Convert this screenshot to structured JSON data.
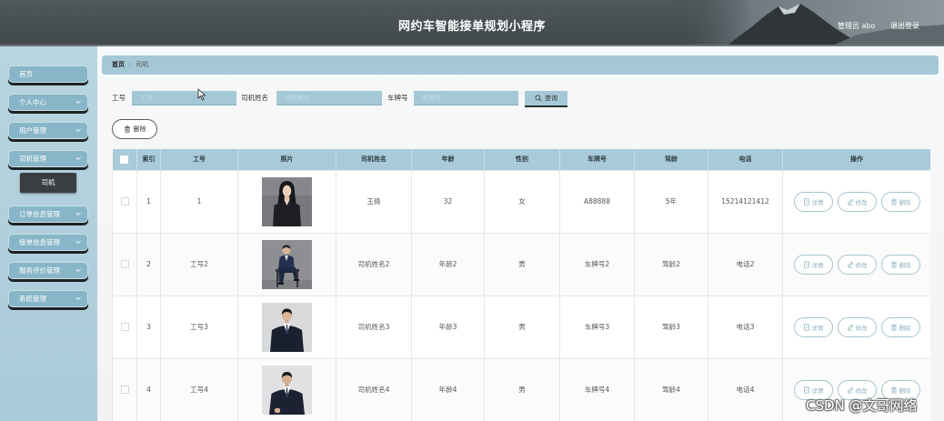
{
  "header": {
    "title": "网约车智能接单规划小程序",
    "user_label": "管理员 abo",
    "logout_label": "退出登录"
  },
  "sidebar": {
    "items": [
      {
        "label": "首页",
        "expandable": false
      },
      {
        "label": "个人中心",
        "expandable": true
      },
      {
        "label": "用户管理",
        "expandable": true
      },
      {
        "label": "司机管理",
        "expandable": true,
        "expanded": true,
        "children": [
          {
            "label": "司机",
            "active": true
          }
        ]
      },
      {
        "label": "订单信息管理",
        "expandable": true
      },
      {
        "label": "接单信息管理",
        "expandable": true
      },
      {
        "label": "服务评价管理",
        "expandable": true
      },
      {
        "label": "系统管理",
        "expandable": true
      }
    ],
    "chevron_icon": "chevron-down-icon"
  },
  "breadcrumb": {
    "home": "首页",
    "separator": "/",
    "current": "司机"
  },
  "search": {
    "fields": [
      {
        "label": "工号",
        "value": "",
        "placeholder": "工号"
      },
      {
        "label": "司机姓名",
        "value": "",
        "placeholder": "司机姓名"
      },
      {
        "label": "车牌号",
        "value": "",
        "placeholder": "车牌号"
      }
    ],
    "button_label": "查询",
    "button_icon": "search-icon"
  },
  "toolbar": {
    "delete_label": "删除",
    "delete_icon": "trash-icon"
  },
  "table": {
    "columns": [
      "索引",
      "工号",
      "照片",
      "司机姓名",
      "年龄",
      "性别",
      "车牌号",
      "驾龄",
      "电话",
      "操作"
    ],
    "rows": [
      {
        "index": "1",
        "job_no": "1",
        "name": "王倩",
        "age": "32",
        "gender": "女",
        "plate": "A88888",
        "driving_years": "5年",
        "phone": "15214121412"
      },
      {
        "index": "2",
        "job_no": "工号2",
        "name": "司机姓名2",
        "age": "年龄2",
        "gender": "男",
        "plate": "车牌号2",
        "driving_years": "驾龄2",
        "phone": "电话2"
      },
      {
        "index": "3",
        "job_no": "工号3",
        "name": "司机姓名3",
        "age": "年龄3",
        "gender": "男",
        "plate": "车牌号3",
        "driving_years": "驾龄3",
        "phone": "电话3"
      },
      {
        "index": "4",
        "job_no": "工号4",
        "name": "司机姓名4",
        "age": "年龄4",
        "gender": "男",
        "plate": "车牌号4",
        "driving_years": "驾龄4",
        "phone": "电话4"
      }
    ],
    "row_actions": [
      {
        "label": "详情",
        "icon": "file-icon"
      },
      {
        "label": "修改",
        "icon": "edit-icon"
      },
      {
        "label": "删除",
        "icon": "trash-icon"
      }
    ]
  },
  "watermark": "CSDN @文哥网络",
  "colors": {
    "header_bg": "#41484b",
    "sidebar_bg": "#a9cad8",
    "accent": "#a5c8d6",
    "table_header_bg": "#a9cbd9",
    "submenu_active_bg": "#3b3e40",
    "nav_item_bg": "#88b6c8"
  }
}
